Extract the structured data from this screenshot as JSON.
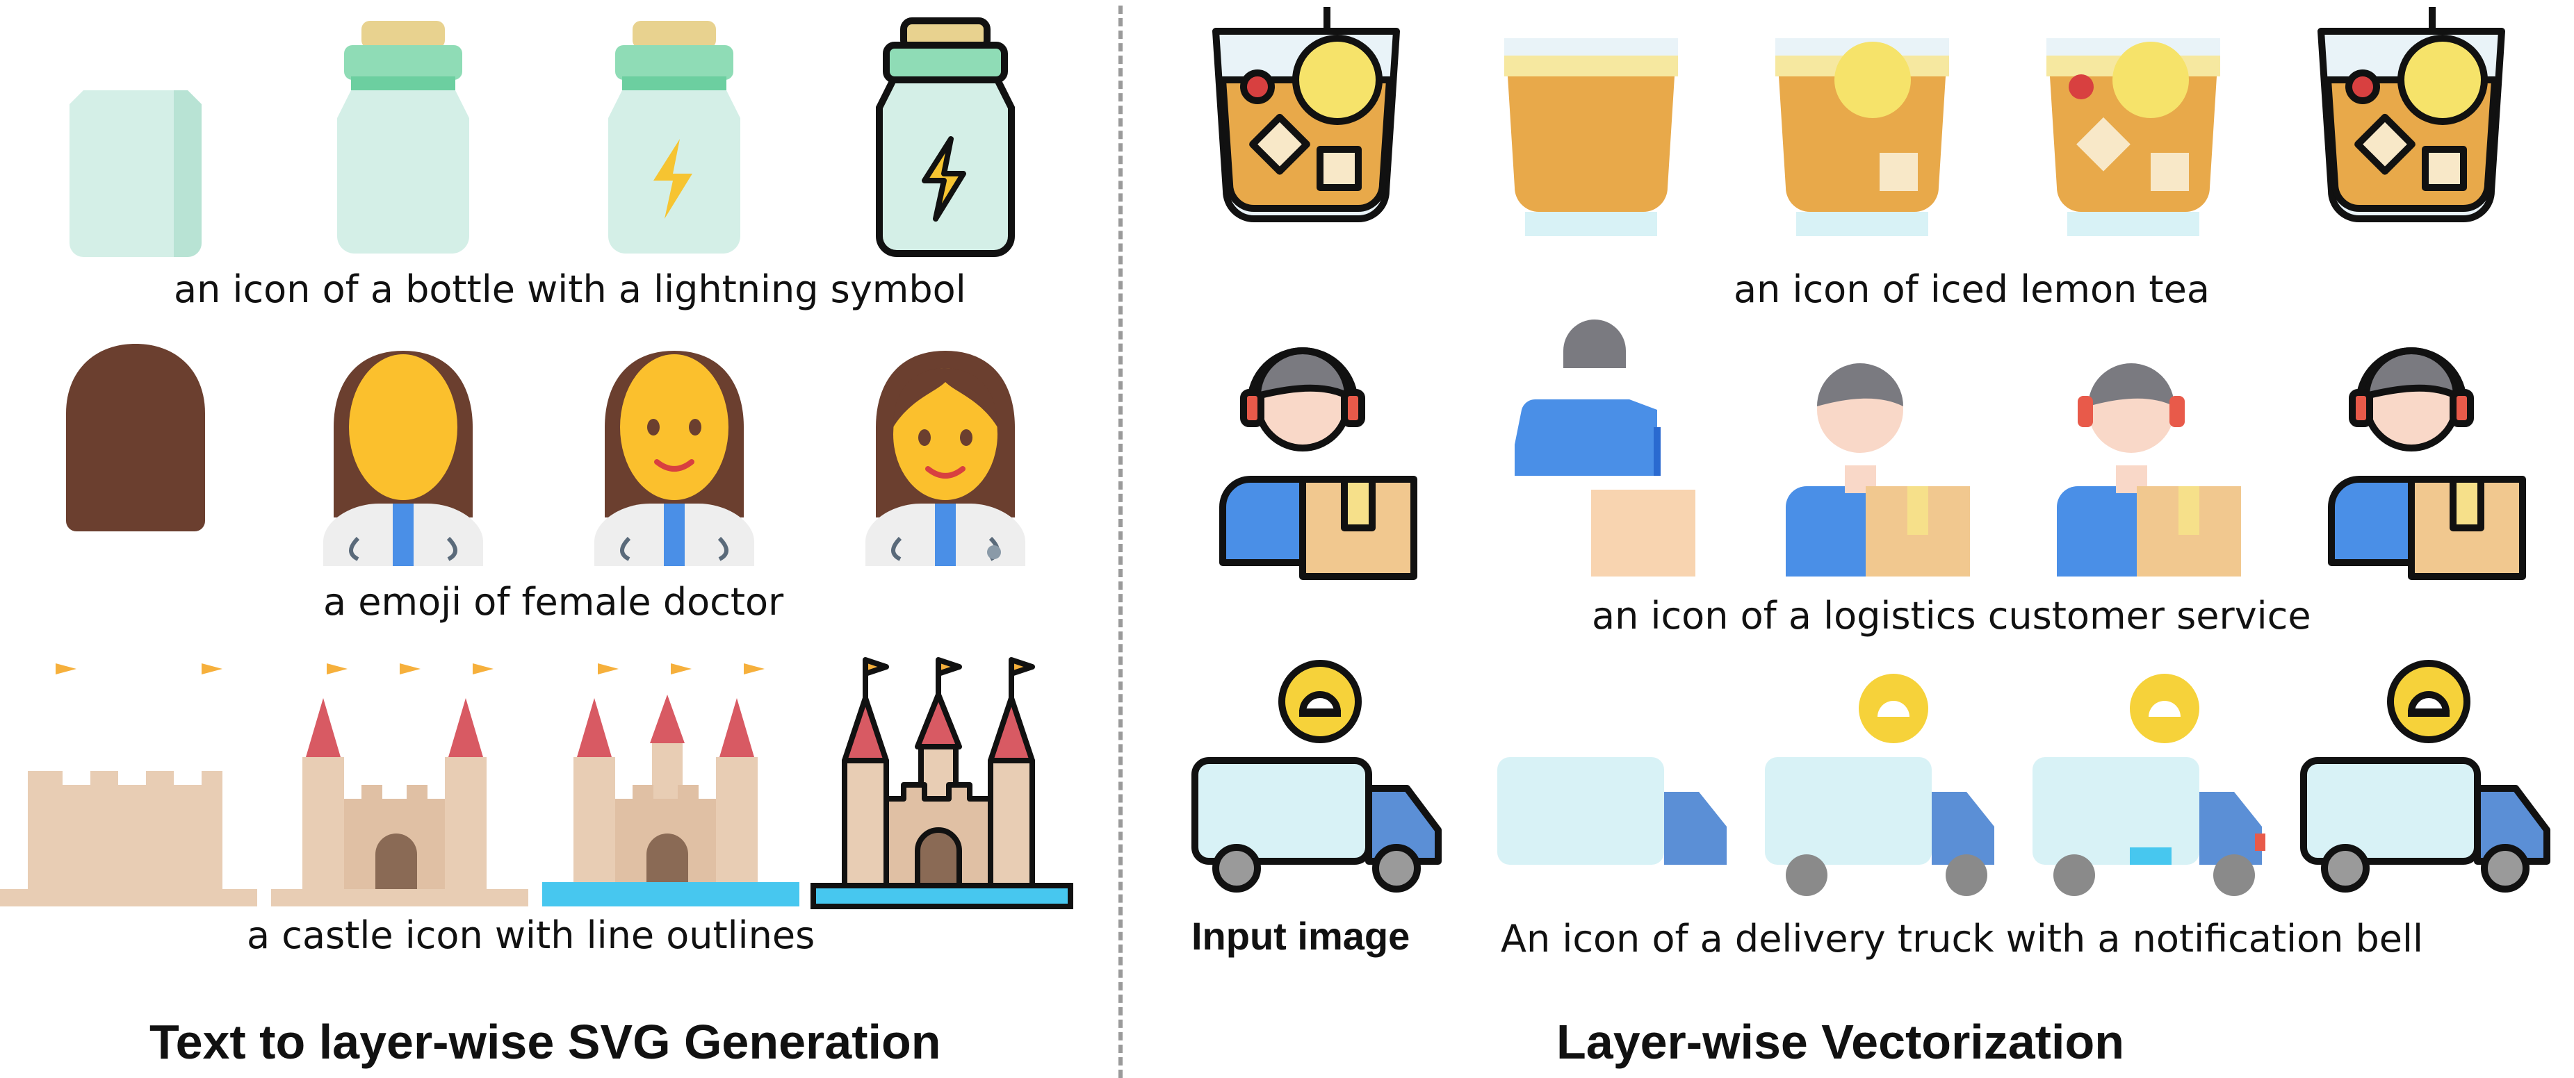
{
  "left": {
    "heading": "Text to layer-wise SVG Generation",
    "rows": [
      {
        "caption": "an icon of a bottle with a lightning symbol",
        "icon": "bottle-icon"
      },
      {
        "caption": "a emoji of female doctor",
        "icon": "female-doctor-icon"
      },
      {
        "caption": "a castle icon with line outlines",
        "icon": "castle-icon"
      }
    ]
  },
  "right": {
    "heading": "Layer-wise Vectorization",
    "input_label": "Input image",
    "rows": [
      {
        "caption": "an icon of iced lemon tea",
        "icon": "iced-tea-icon"
      },
      {
        "caption": "an icon of a logistics customer service",
        "icon": "customer-service-icon"
      },
      {
        "caption": "An icon of a delivery truck with a notification bell",
        "icon": "delivery-truck-icon"
      }
    ]
  },
  "colors": {
    "outline": "#111111",
    "bottle_glass": "#d4efe7",
    "bottle_cap": "#8fdcb6",
    "cork": "#e8d28f",
    "bolt": "#f6c431",
    "hair": "#6b3f2f",
    "face": "#fbc02d",
    "tea": "#e8a94a",
    "cup_rim": "#e9f3f8",
    "lemon": "#f6e36a",
    "shirt": "#4a8fe7",
    "box": "#f1c88f",
    "truck_body": "#d8f2f6",
    "truck_cab": "#5b8fd6",
    "bell_bubble": "#f6d23a",
    "castle_sand": "#e8cdb4",
    "roof": "#d85a63",
    "flag": "#f6b03c",
    "water": "#47c7ef"
  }
}
